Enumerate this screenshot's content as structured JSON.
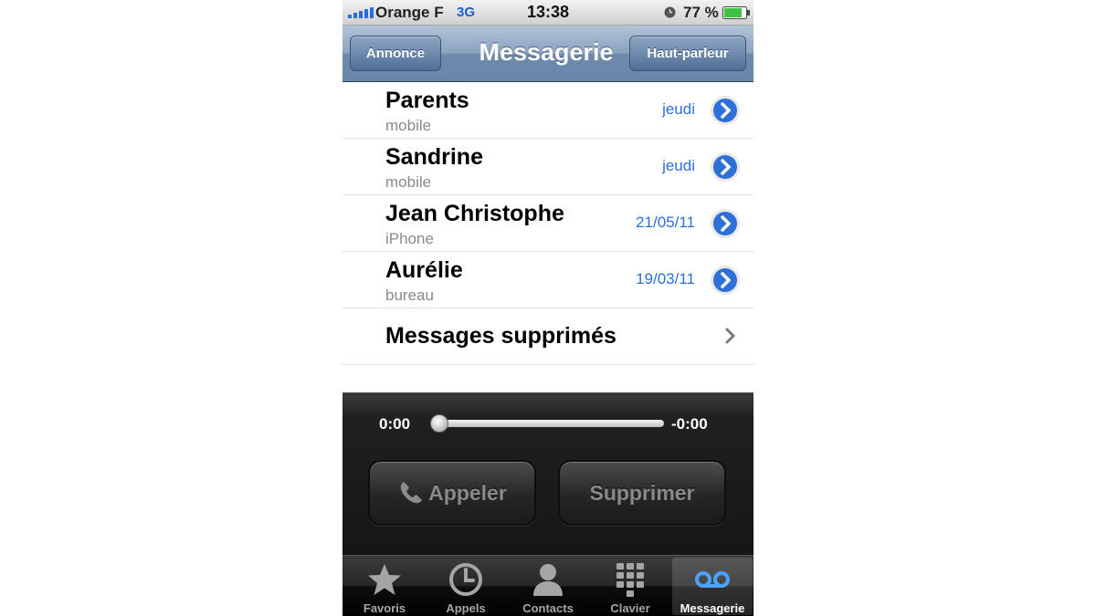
{
  "status_bar": {
    "carrier": "Orange F",
    "network": "3G",
    "time": "13:38",
    "battery_percent": "77 %",
    "signal_icon": "signal-bars-icon",
    "alarm_icon": "clock-icon",
    "battery_icon": "battery-icon",
    "battery_color": "#3fc23f"
  },
  "nav": {
    "left_button": "Annonce",
    "title": "Messagerie",
    "right_button": "Haut-parleur"
  },
  "messages": [
    {
      "name": "Parents",
      "type": "mobile",
      "date": "jeudi"
    },
    {
      "name": "Sandrine",
      "type": "mobile",
      "date": "jeudi"
    },
    {
      "name": "Jean Christophe",
      "type": "iPhone",
      "date": "21/05/11"
    },
    {
      "name": "Aurélie",
      "type": "bureau",
      "date": "19/03/11"
    }
  ],
  "deleted_messages_label": "Messages supprimés",
  "player": {
    "elapsed": "0:00",
    "remaining": "-0:00",
    "progress": 0,
    "call_button": "Appeler",
    "delete_button": "Supprimer"
  },
  "tabs": [
    {
      "label": "Favoris",
      "icon": "star-icon",
      "active": false
    },
    {
      "label": "Appels",
      "icon": "clock-icon",
      "active": false
    },
    {
      "label": "Contacts",
      "icon": "person-icon",
      "active": false
    },
    {
      "label": "Clavier",
      "icon": "keypad-icon",
      "active": false
    },
    {
      "label": "Messagerie",
      "icon": "voicemail-icon",
      "active": true
    }
  ],
  "colors": {
    "accent_blue": "#2f6fd8",
    "nav_bar": "#6d89ab"
  }
}
